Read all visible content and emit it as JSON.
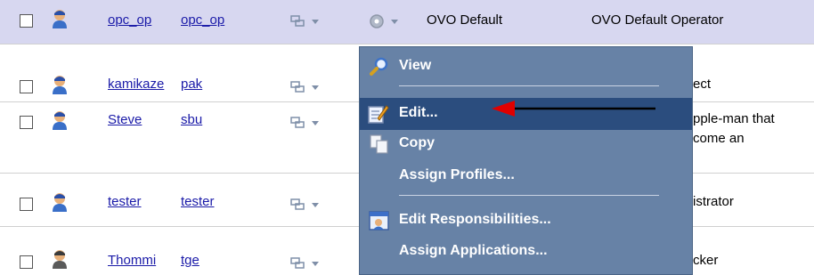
{
  "rows": [
    {
      "login": "opc_op",
      "user": "opc_op",
      "profile": "OVO Default",
      "description": "OVO Default Operator"
    },
    {
      "login": "kamikaze",
      "user": "pak",
      "description": "ect"
    },
    {
      "login": "Steve",
      "user": "sbu",
      "description_line1": "pple-man that",
      "description_line2": "come an"
    },
    {
      "login": "tester",
      "user": "tester",
      "description": "istrator"
    },
    {
      "login": "Thommi",
      "user": "tge",
      "description": "cker"
    }
  ],
  "menu": {
    "items": [
      {
        "label": "View",
        "icon": "magnifier-icon"
      },
      {
        "label": "Edit...",
        "icon": "edit-icon"
      },
      {
        "label": "Copy",
        "icon": "copy-icon"
      },
      {
        "label": "Assign Profiles..."
      },
      {
        "label": "Edit Responsibilities...",
        "icon": "responsibilities-icon"
      },
      {
        "label": "Assign Applications..."
      }
    ],
    "selected": "Edit...",
    "colors": {
      "background": "#6782a6",
      "selected": "#2b4d7e",
      "annotation_arrow": "#e00000"
    }
  }
}
